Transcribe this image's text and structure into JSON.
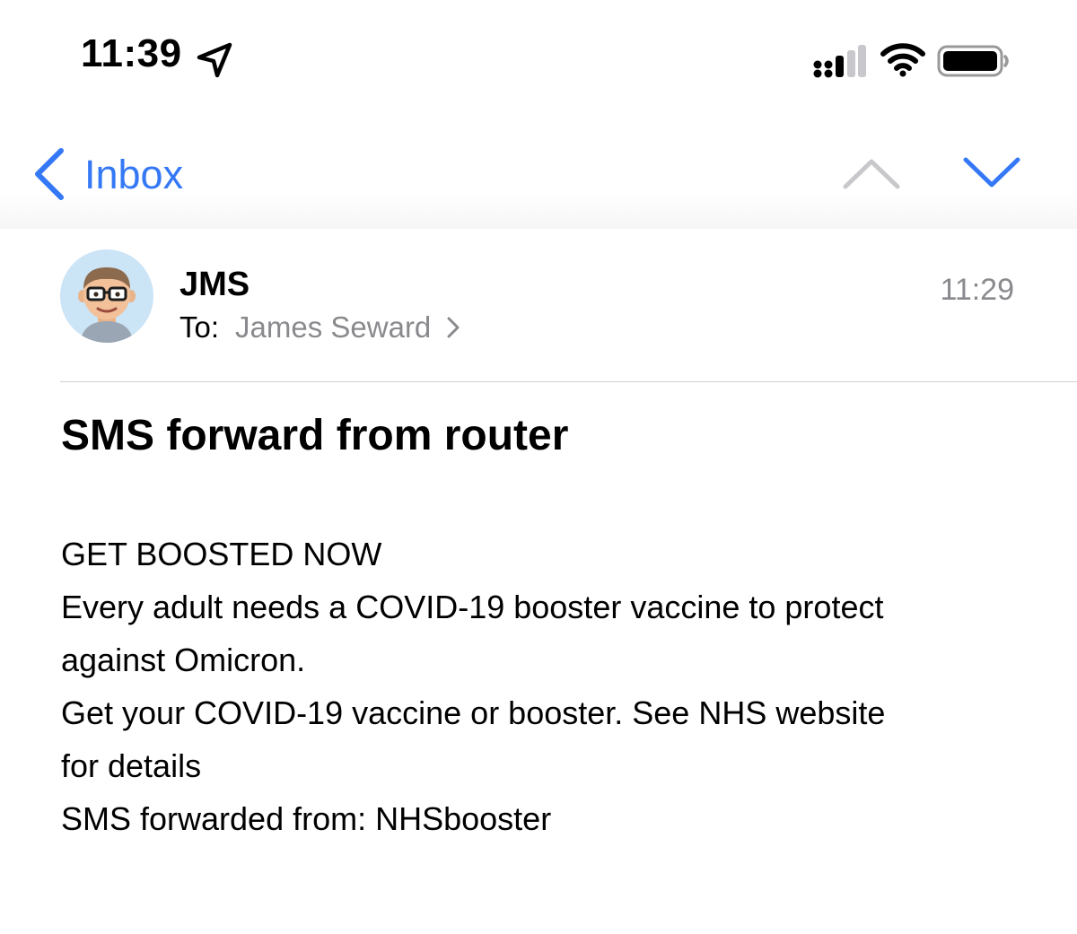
{
  "status_bar": {
    "time": "11:39",
    "icons": [
      "location-arrow-icon",
      "signal-icon",
      "wifi-icon",
      "battery-icon"
    ]
  },
  "nav": {
    "back_label": "Inbox",
    "icons": [
      "chevron-left-icon",
      "chevron-up-icon",
      "chevron-down-icon"
    ]
  },
  "header": {
    "sender": "JMS",
    "to_label": "To:",
    "recipient": "James Seward",
    "time": "11:29"
  },
  "subject": "SMS forward from router",
  "body": {
    "lines": [
      "GET BOOSTED NOW",
      "Every adult needs a COVID-19 booster vaccine to protect",
      "against Omicron.",
      "Get your COVID-19 vaccine or booster. See NHS website",
      "for details",
      "SMS forwarded from: NHSbooster"
    ]
  },
  "colors": {
    "accent": "#3478f6",
    "secondary_text": "#8a8a8e",
    "nav_disabled": "#c7c7cc",
    "avatar_bg": "#cbe4f6"
  }
}
